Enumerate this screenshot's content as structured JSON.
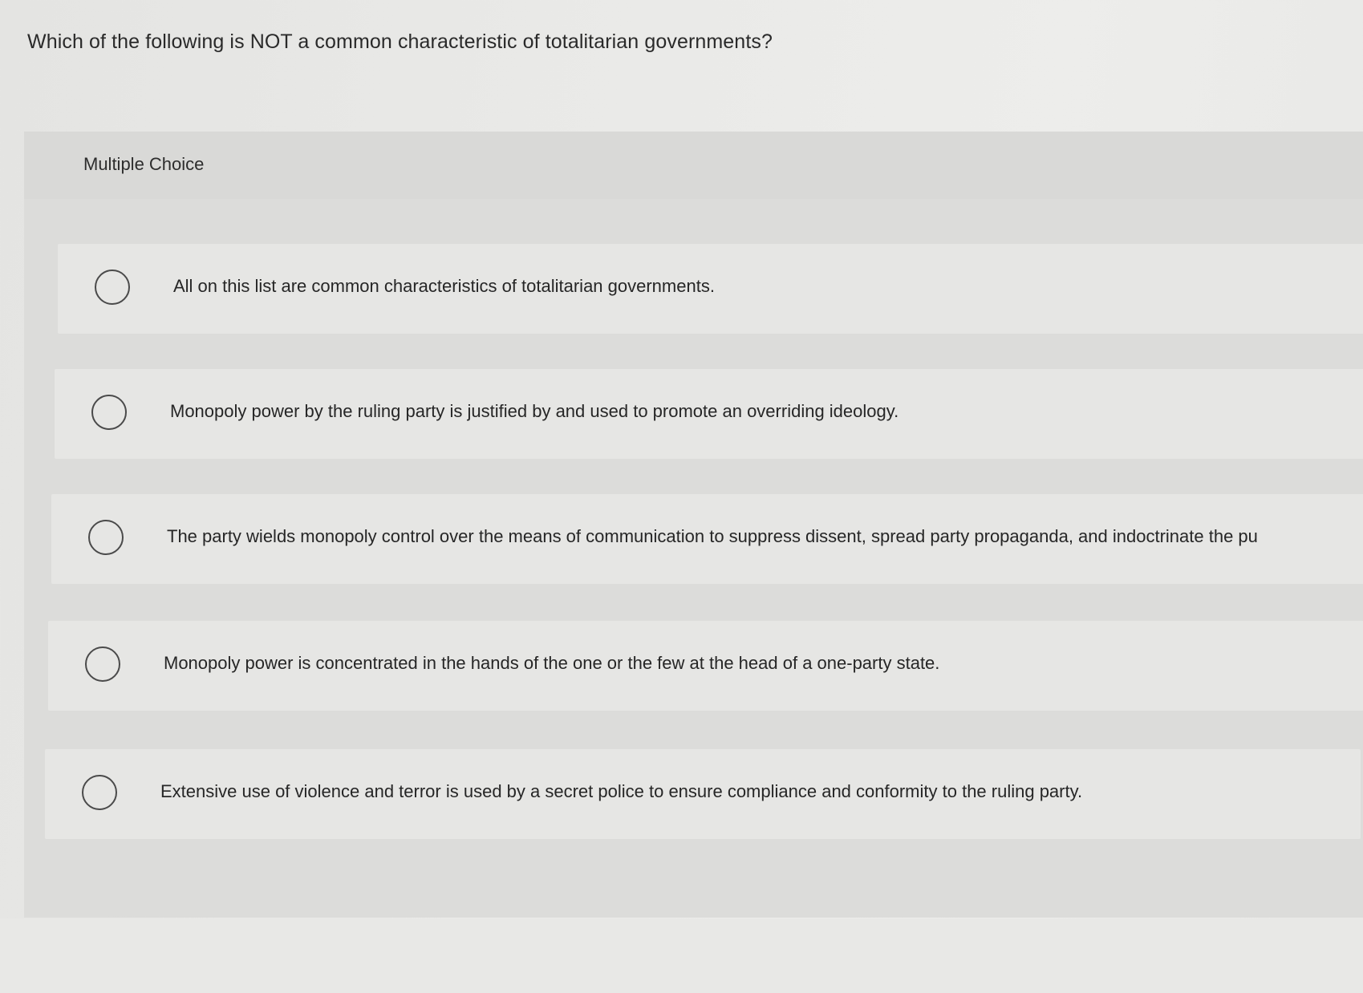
{
  "question": {
    "text": "Which of the following is NOT a common characteristic of totalitarian governments?"
  },
  "quiz": {
    "type_label": "Multiple Choice",
    "choices": [
      {
        "text": "All on this list are common characteristics of totalitarian governments.",
        "selected": false
      },
      {
        "text": "Monopoly power by the ruling party is justified by and used to promote an overriding ideology.",
        "selected": false
      },
      {
        "text": "The party wields monopoly control over the means of communication to suppress dissent, spread party propaganda, and indoctrinate the pu",
        "selected": false
      },
      {
        "text": "Monopoly power is concentrated in the hands of the one or the few at the head of a one-party state.",
        "selected": false
      },
      {
        "text": "Extensive use of violence and terror is used by a secret police to ensure compliance and conformity to the ruling party.",
        "selected": false
      }
    ]
  }
}
